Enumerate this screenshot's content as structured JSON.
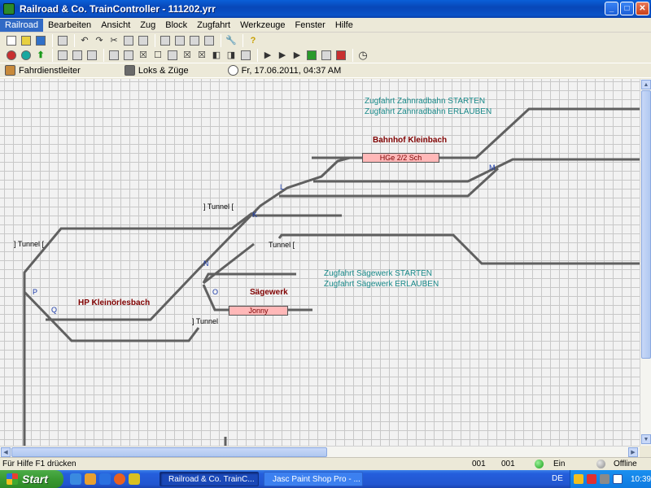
{
  "window": {
    "title": "Railroad & Co. TrainController - 111202.yrr"
  },
  "menu": [
    "Railroad",
    "Bearbeiten",
    "Ansicht",
    "Zug",
    "Block",
    "Zugfahrt",
    "Werkzeuge",
    "Fenster",
    "Hilfe"
  ],
  "infobar": {
    "dispatcher": "Fahrdienstleiter",
    "locos": "Loks & Züge",
    "datetime": "Fr, 17.06.2011, 04:37 AM"
  },
  "layout": {
    "stations": [
      {
        "name": "Bahnhof Kleinbach"
      },
      {
        "name": "HP Kleinörlesbach"
      },
      {
        "name": "Sägewerk"
      }
    ],
    "trains": [
      {
        "name": "HGe 2/2 Sch"
      },
      {
        "name": "Jonny"
      }
    ],
    "tunnels": [
      "] Tunnel [",
      "] Tunnel [",
      "] Tunnel",
      "Tunnel ["
    ],
    "signals": [
      "L",
      "K",
      "M",
      "N",
      "O",
      "P",
      "Q"
    ],
    "routes": [
      {
        "label": "Zugfahrt Zahnradbahn STARTEN"
      },
      {
        "label": "Zugfahrt Zahnradbahn ERLAUBEN"
      },
      {
        "label": "Zugfahrt Sägewerk STARTEN"
      },
      {
        "label": "Zugfahrt Sägewerk ERLAUBEN"
      }
    ]
  },
  "status": {
    "hint": "Für Hilfe F1 drücken",
    "field1": "001",
    "field2": "001",
    "power": "Ein",
    "connection": "Offline"
  },
  "taskbar": {
    "start": "Start",
    "tasks": [
      "Railroad & Co. TrainC...",
      "Jasc Paint Shop Pro - ..."
    ],
    "lang": "DE",
    "clock": "10:39"
  },
  "colors": {
    "track": "#606060",
    "block_fill": "#ffffe0",
    "occupied_fill": "#ffb8b8",
    "station_text": "#800000",
    "route_text": "#1a8a8a",
    "signal_letter": "#1a3aa8"
  }
}
